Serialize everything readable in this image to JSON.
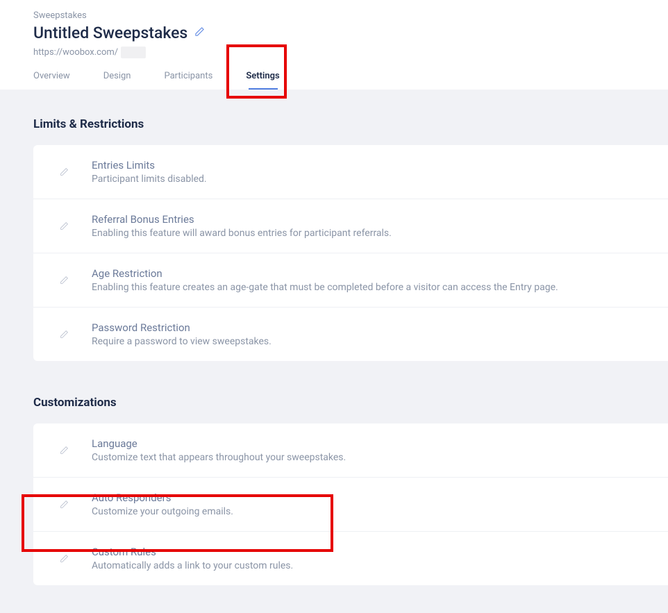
{
  "header": {
    "breadcrumb": "Sweepstakes",
    "title": "Untitled Sweepstakes",
    "url_base": "https://woobox.com/",
    "url_slug": ""
  },
  "tabs": {
    "overview": "Overview",
    "design": "Design",
    "participants": "Participants",
    "settings": "Settings"
  },
  "sections": {
    "limits": {
      "title": "Limits & Restrictions",
      "items": [
        {
          "title": "Entries Limits",
          "desc": "Participant limits disabled."
        },
        {
          "title": "Referral Bonus Entries",
          "desc": "Enabling this feature will award bonus entries for participant referrals."
        },
        {
          "title": "Age Restriction",
          "desc": "Enabling this feature creates an age-gate that must be completed before a visitor can access the Entry page."
        },
        {
          "title": "Password Restriction",
          "desc": "Require a password to view sweepstakes."
        }
      ]
    },
    "customizations": {
      "title": "Customizations",
      "items": [
        {
          "title": "Language",
          "desc": "Customize text that appears throughout your sweepstakes."
        },
        {
          "title": "Auto Responders",
          "desc": "Customize your outgoing emails."
        },
        {
          "title": "Custom Rules",
          "desc": "Automatically adds a link to your custom rules."
        }
      ]
    }
  }
}
